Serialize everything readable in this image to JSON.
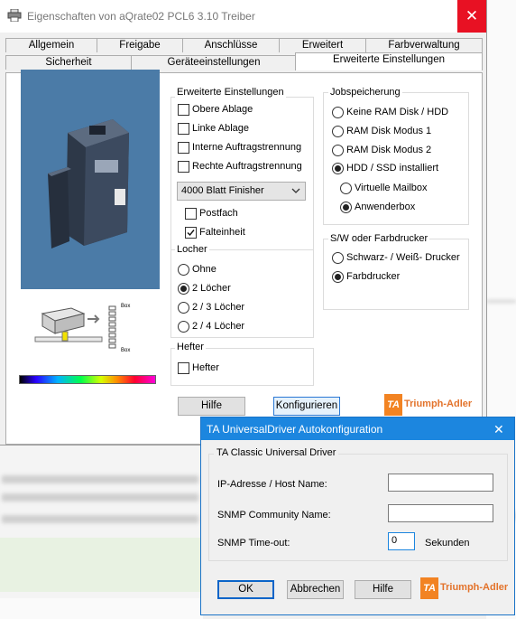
{
  "window": {
    "title": "Eigenschaften von aQrate02 PCL6 3.10 Treiber",
    "close_symbol": "✕"
  },
  "tabs_row1": [
    "Allgemein",
    "Freigabe",
    "Anschlüsse",
    "Erweitert",
    "Farbverwaltung"
  ],
  "tabs_row2": [
    "Sicherheit",
    "Geräteeinstellungen",
    "Erweiterte Einstellungen"
  ],
  "active_tab": "Erweiterte Einstellungen",
  "erweiterte": {
    "label": "Erweiterte Einstellungen",
    "options": [
      {
        "label": "Obere Ablage",
        "checked": false
      },
      {
        "label": "Linke Ablage",
        "checked": false
      },
      {
        "label": "Interne Auftragstrennung",
        "checked": false
      },
      {
        "label": "Rechte Auftragstrennung",
        "checked": false
      }
    ],
    "finisher_value": "4000 Blatt Finisher",
    "sub_options": [
      {
        "label": "Postfach",
        "checked": false
      },
      {
        "label": "Falteinheit",
        "checked": true
      }
    ]
  },
  "locher": {
    "label": "Locher",
    "options": [
      {
        "label": "Ohne",
        "selected": false
      },
      {
        "label": "2 Löcher",
        "selected": true
      },
      {
        "label": "2 / 3 Löcher",
        "selected": false
      },
      {
        "label": "2 / 4 Löcher",
        "selected": false
      }
    ]
  },
  "hefter": {
    "label": "Hefter",
    "option": {
      "label": "Hefter",
      "checked": false
    }
  },
  "jobspeicherung": {
    "label": "Jobspeicherung",
    "options": [
      {
        "label": "Keine RAM Disk / HDD",
        "selected": false
      },
      {
        "label": "RAM Disk Modus 1",
        "selected": false
      },
      {
        "label": "RAM Disk Modus 2",
        "selected": false
      },
      {
        "label": "HDD / SSD installiert",
        "selected": true
      }
    ],
    "sub_options": [
      {
        "label": "Virtuelle Mailbox",
        "selected": false
      },
      {
        "label": "Anwenderbox",
        "selected": true
      }
    ]
  },
  "farbe": {
    "label": "S/W oder Farbdrucker",
    "options": [
      {
        "label": "Schwarz- / Weiß- Drucker",
        "selected": false
      },
      {
        "label": "Farbdrucker",
        "selected": true
      }
    ]
  },
  "buttons": {
    "hilfe": "Hilfe",
    "konfigurieren": "Konfigurieren"
  },
  "brand": {
    "mark": "TA",
    "name": "Triumph-Adler",
    "color": "#f28322"
  },
  "tray_labels": [
    "Box",
    "Box"
  ],
  "autoconfig": {
    "title": "TA UniversalDriver Autokonfiguration",
    "close_symbol": "✕",
    "group_label": "TA Classic Universal Driver",
    "ip_label": "IP-Adresse / Host Name:",
    "ip_value": "",
    "snmp_label": "SNMP Community Name:",
    "snmp_value": "",
    "timeout_label": "SNMP Time-out:",
    "timeout_value": "0",
    "timeout_unit": "Sekunden",
    "ok": "OK",
    "abbrechen": "Abbrechen",
    "hilfe": "Hilfe"
  },
  "colors": {
    "accent_blue": "#1c86df",
    "close_red": "#e81123",
    "image_bg": "#4b7ba7"
  }
}
